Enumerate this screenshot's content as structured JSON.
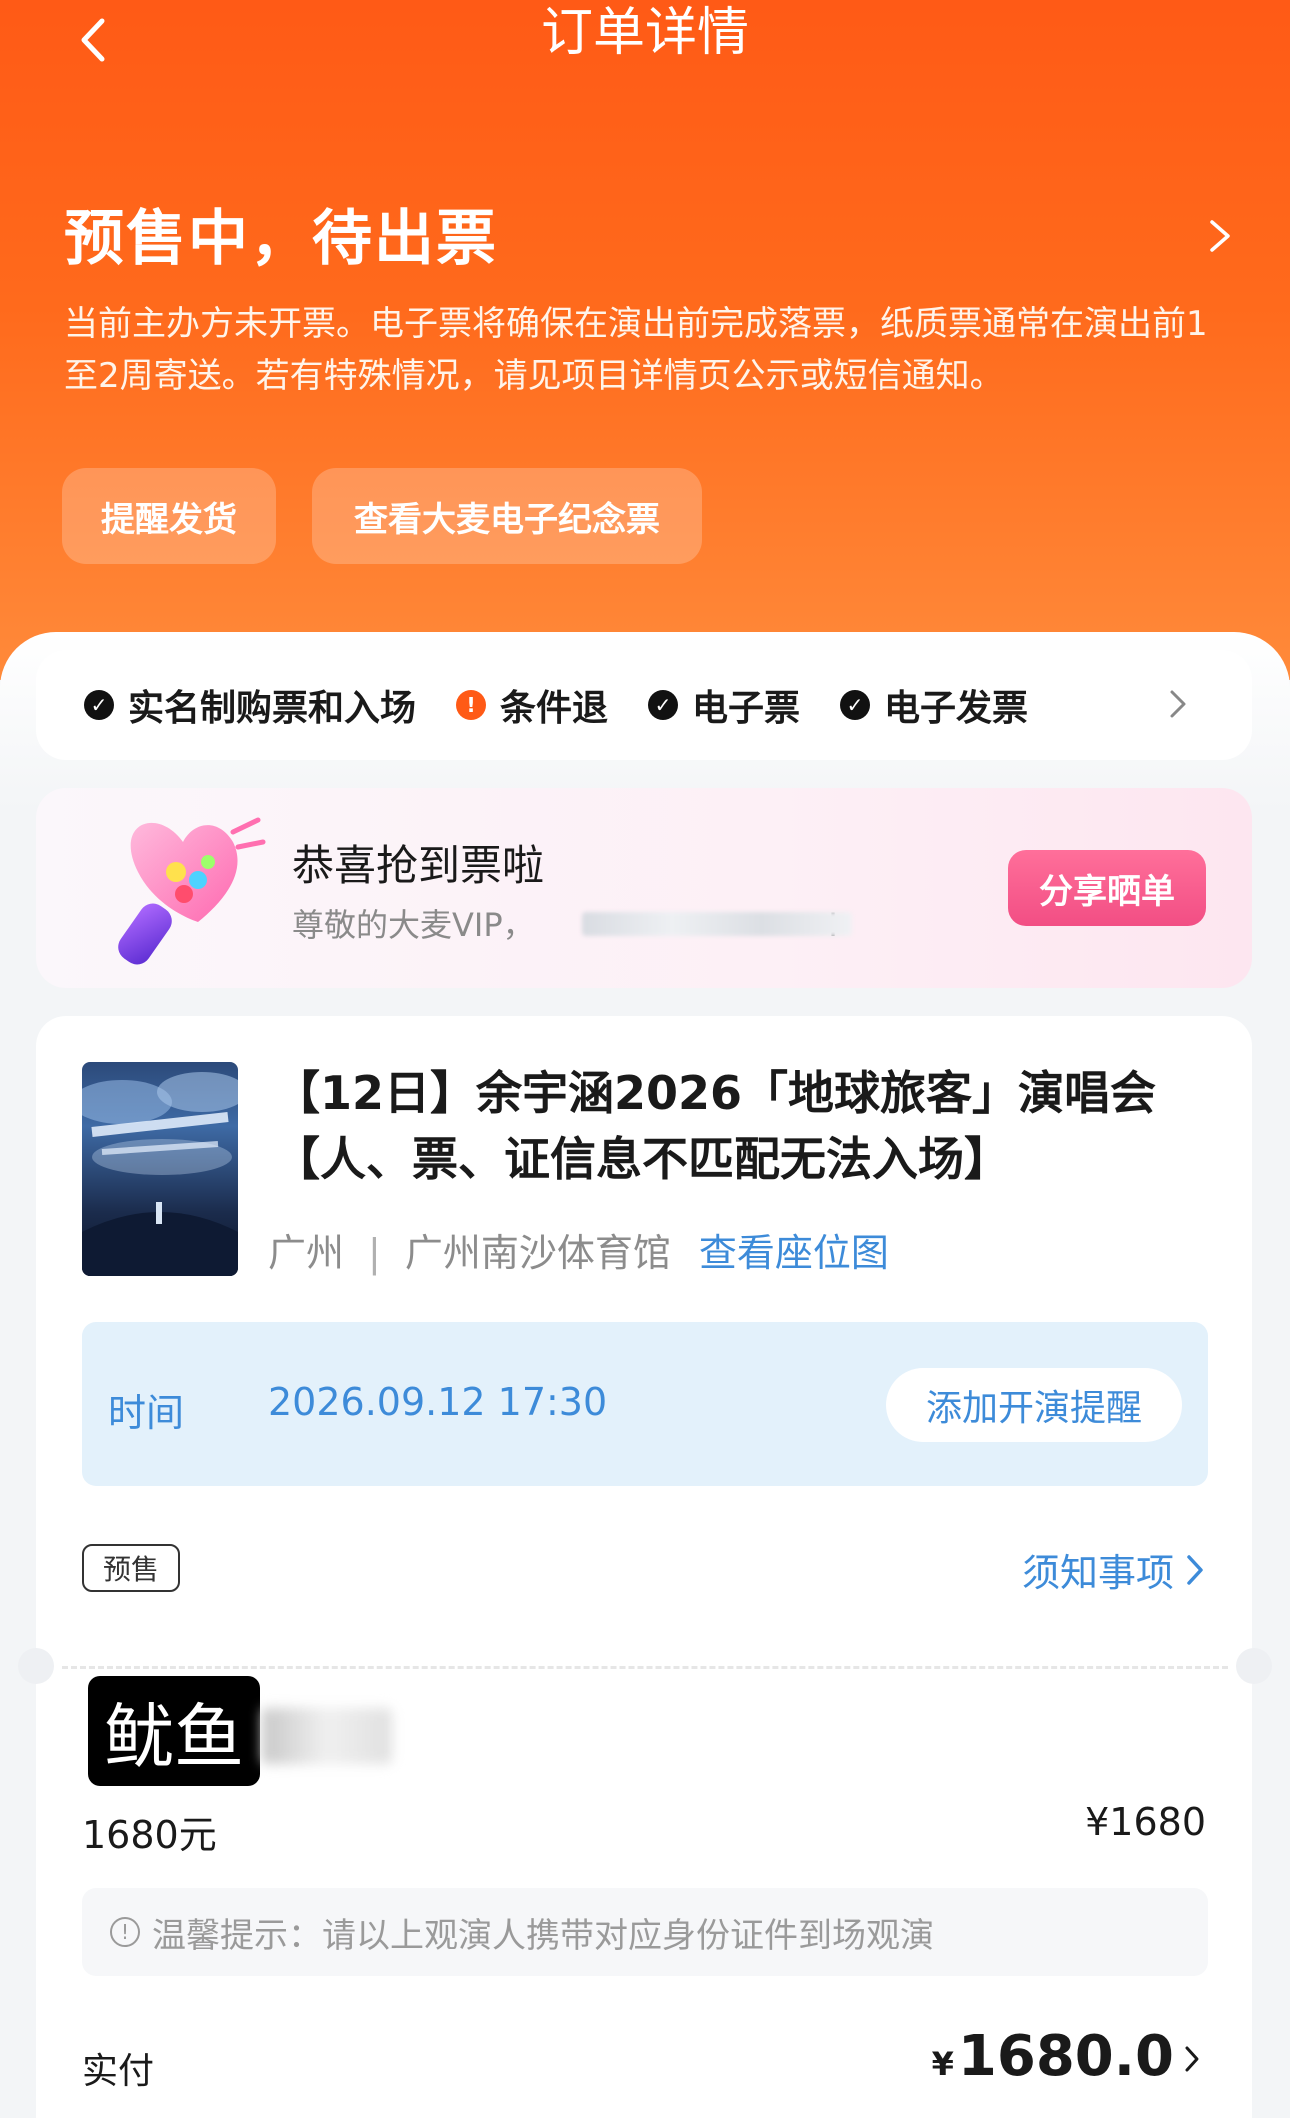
{
  "header": {
    "title": "订单详情"
  },
  "status": {
    "title": "预售中，待出票",
    "description": "当前主办方未开票。电子票将确保在演出前完成落票，纸质票通常在演出前1至2周寄送。若有特殊情况，请见项目详情页公示或短信通知。",
    "remind_button": "提醒发货",
    "souvenir_button": "查看大麦电子纪念票"
  },
  "features": [
    {
      "label": "实名制购票和入场",
      "icon": "check-icon"
    },
    {
      "label": "条件退",
      "icon": "warning-icon"
    },
    {
      "label": "电子票",
      "icon": "check-icon"
    },
    {
      "label": "电子发票",
      "icon": "check-icon"
    }
  ],
  "vip": {
    "title": "恭喜抢到票啦",
    "subtitle": "尊敬的大麦VIP，",
    "subtitle_end": "!",
    "share_button": "分享晒单"
  },
  "event": {
    "title": "【12日】余宇涵2026「地球旅客」演唱会【人、票、证信息不匹配无法入场】",
    "city": "广州",
    "separator": "|",
    "venue": "广州南沙体育馆",
    "seat_map_link": "查看座位图",
    "time_label": "时间",
    "time_value": "2026.09.12 17:30",
    "add_reminder": "添加开演提醒",
    "presale_tag": "预售",
    "notice_link": "须知事项"
  },
  "ticket": {
    "holder": "鱿鱼",
    "price_label": "1680元",
    "amount": "¥1680",
    "tip": "温馨提示：请以上观演人携带对应身份证件到场观演"
  },
  "payment": {
    "label": "实付",
    "currency": "¥",
    "amount": "1680.0"
  },
  "colors": {
    "primary_orange": "#ff5a16",
    "link_blue": "#3d8bd9",
    "share_pink": "#f24e84"
  }
}
